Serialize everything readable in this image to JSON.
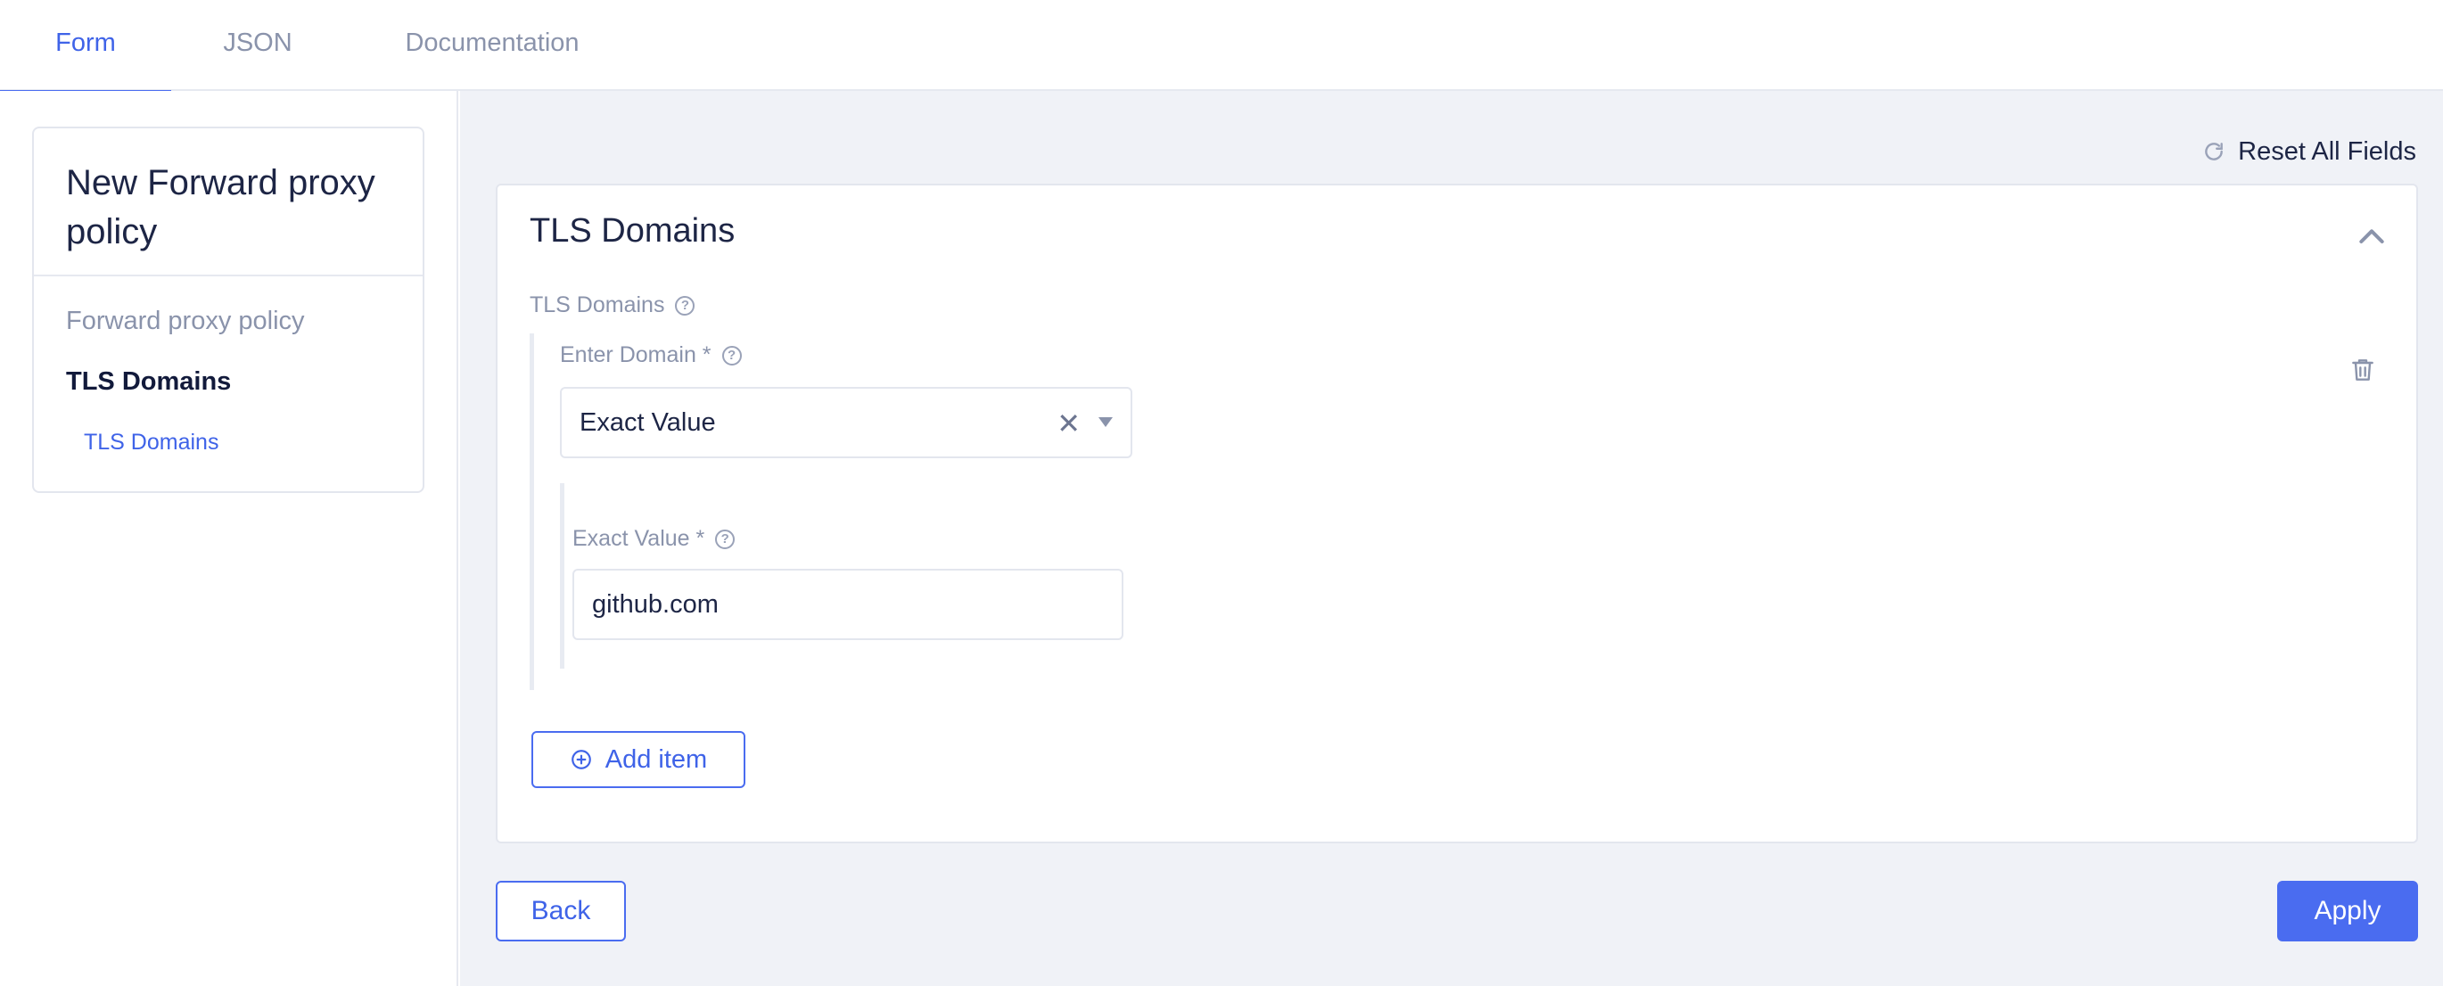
{
  "tabs": [
    {
      "label": "Form",
      "active": true
    },
    {
      "label": "JSON",
      "active": false
    },
    {
      "label": "Documentation",
      "active": false
    }
  ],
  "sidebar": {
    "title": "New Forward proxy policy",
    "items": [
      {
        "label": "Forward proxy policy"
      },
      {
        "label": "TLS Domains"
      },
      {
        "label": "TLS Domains"
      }
    ]
  },
  "main": {
    "reset_label": "Reset All Fields",
    "panel": {
      "title": "TLS Domains",
      "field_label": "TLS Domains",
      "domain_label": "Enter Domain *",
      "domain_select_value": "Exact Value",
      "exact_label": "Exact Value *",
      "exact_value": "github.com",
      "add_item_label": "Add item"
    },
    "back_label": "Back",
    "apply_label": "Apply"
  },
  "icons": {
    "reset": "refresh-icon",
    "collapse": "chevron-up-icon",
    "help": "question-circle-icon",
    "delete": "trash-icon",
    "clear": "close-icon",
    "dropdown": "caret-down-icon",
    "add": "plus-circle-icon"
  },
  "colors": {
    "accent": "#4a6cf0",
    "background": "#f0f2f7",
    "muted_text": "#8a93ab"
  }
}
